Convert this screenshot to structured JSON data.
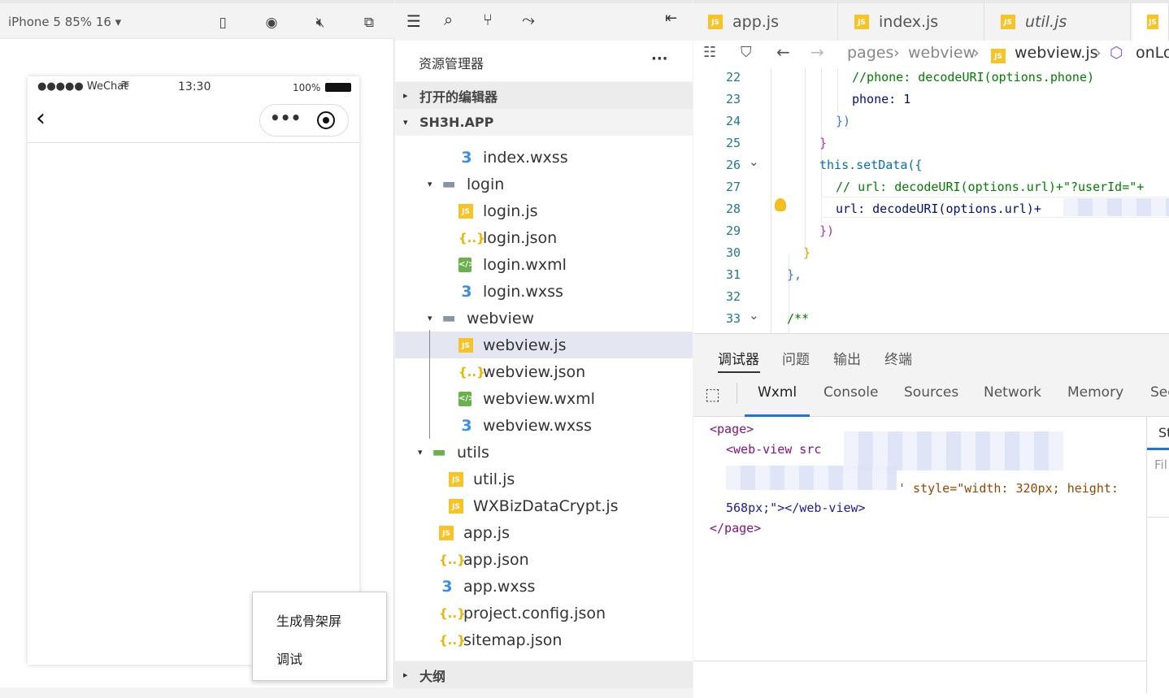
{
  "simulator": {
    "device_label": "iPhone 5 85% 16 ▾",
    "status": {
      "carrier": "●●●●● WeChat",
      "time": "13:30",
      "battery": "100%"
    },
    "context_menu": [
      "生成骨架屏",
      "调试"
    ]
  },
  "explorer": {
    "title": "资源管理器",
    "more": "···",
    "sections": {
      "open_editors": "打开的编辑器",
      "project": "SH3H.APP",
      "outline": "大纲"
    },
    "files": [
      {
        "name": "index.wxss",
        "type": "wxss",
        "indent": 1
      },
      {
        "name": "login",
        "type": "folder",
        "indent": 0
      },
      {
        "name": "login.js",
        "type": "js",
        "indent": 1
      },
      {
        "name": "login.json",
        "type": "json",
        "indent": 1
      },
      {
        "name": "login.wxml",
        "type": "wxml",
        "indent": 1
      },
      {
        "name": "login.wxss",
        "type": "wxss",
        "indent": 1
      },
      {
        "name": "webview",
        "type": "folder",
        "indent": 0
      },
      {
        "name": "webview.js",
        "type": "js",
        "indent": 1,
        "selected": true
      },
      {
        "name": "webview.json",
        "type": "json",
        "indent": 1
      },
      {
        "name": "webview.wxml",
        "type": "wxml",
        "indent": 1
      },
      {
        "name": "webview.wxss",
        "type": "wxss",
        "indent": 1
      },
      {
        "name": "utils",
        "type": "folder-green",
        "indent": -1
      },
      {
        "name": "util.js",
        "type": "js",
        "indent": 0
      },
      {
        "name": "WXBizDataCrypt.js",
        "type": "js",
        "indent": 0
      },
      {
        "name": "app.js",
        "type": "js",
        "indent": -1
      },
      {
        "name": "app.json",
        "type": "json",
        "indent": -1
      },
      {
        "name": "app.wxss",
        "type": "wxss",
        "indent": -1
      },
      {
        "name": "project.config.json",
        "type": "json",
        "indent": -1
      },
      {
        "name": "sitemap.json",
        "type": "json",
        "indent": -1
      }
    ]
  },
  "editor": {
    "tabs": [
      "app.js",
      "index.js",
      "util.js"
    ],
    "breadcrumb": [
      "pages",
      "webview",
      "webview.js",
      "onLo"
    ],
    "lines": [
      {
        "n": "22",
        "text": "//phone: decodeURI(options.phone)"
      },
      {
        "n": "23",
        "text": "phone: 1"
      },
      {
        "n": "24",
        "text": "})"
      },
      {
        "n": "25",
        "text": "}"
      },
      {
        "n": "26",
        "text": "this.setData({"
      },
      {
        "n": "27",
        "text": "// url: decodeURI(options.url)+\"?userId=\"+"
      },
      {
        "n": "28",
        "text": "url: decodeURI(options.url)+"
      },
      {
        "n": "29",
        "text": "})"
      },
      {
        "n": "30",
        "text": "}"
      },
      {
        "n": "31",
        "text": "},"
      },
      {
        "n": "32",
        "text": ""
      },
      {
        "n": "33",
        "text": "/**"
      }
    ]
  },
  "debugger": {
    "tabs": [
      "调试器",
      "问题",
      "输出",
      "终端"
    ],
    "devtools_tabs": [
      "Wxml",
      "Console",
      "Sources",
      "Network",
      "Memory",
      "Sec"
    ],
    "side_tab": "St",
    "side_filter": "Fil",
    "wxml": {
      "page_open": "<page>",
      "webview_open": "<web-view src",
      "style_attr": "' style=\"width: 320px; height:",
      "style_cont": "568px;\"></web-view>",
      "page_close": "</page>"
    }
  }
}
